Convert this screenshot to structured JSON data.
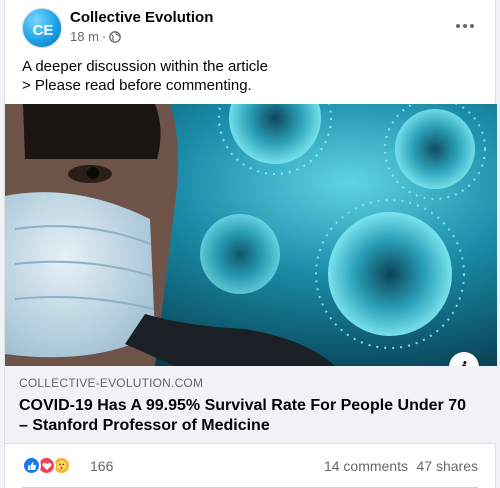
{
  "post": {
    "page_name": "Collective Evolution",
    "avatar_text": "CE",
    "timestamp": "18 m",
    "separator": "·",
    "privacy_icon": "globe-icon",
    "more_icon": "more-horizontal-icon",
    "text_line1": "A deeper discussion within the article",
    "text_line2": "> Please read before commenting."
  },
  "image": {
    "description_icon": "info-icon",
    "info_label": "i"
  },
  "link": {
    "domain": "COLLECTIVE-EVOLUTION.COM",
    "title": "COVID-19 Has A 99.95% Survival Rate For People Under 70 – Stanford Professor of Medicine"
  },
  "footer": {
    "reactions": [
      "like-icon",
      "love-icon",
      "care-icon"
    ],
    "reaction_count": "166",
    "comments": "14 comments",
    "shares": "47 shares"
  },
  "colors": {
    "brand_blue": "#1877f2",
    "love_red": "#f33e58",
    "care_yellow": "#f7b125",
    "secondary_text": "#65676b",
    "link_bg": "#f0f2f5"
  }
}
